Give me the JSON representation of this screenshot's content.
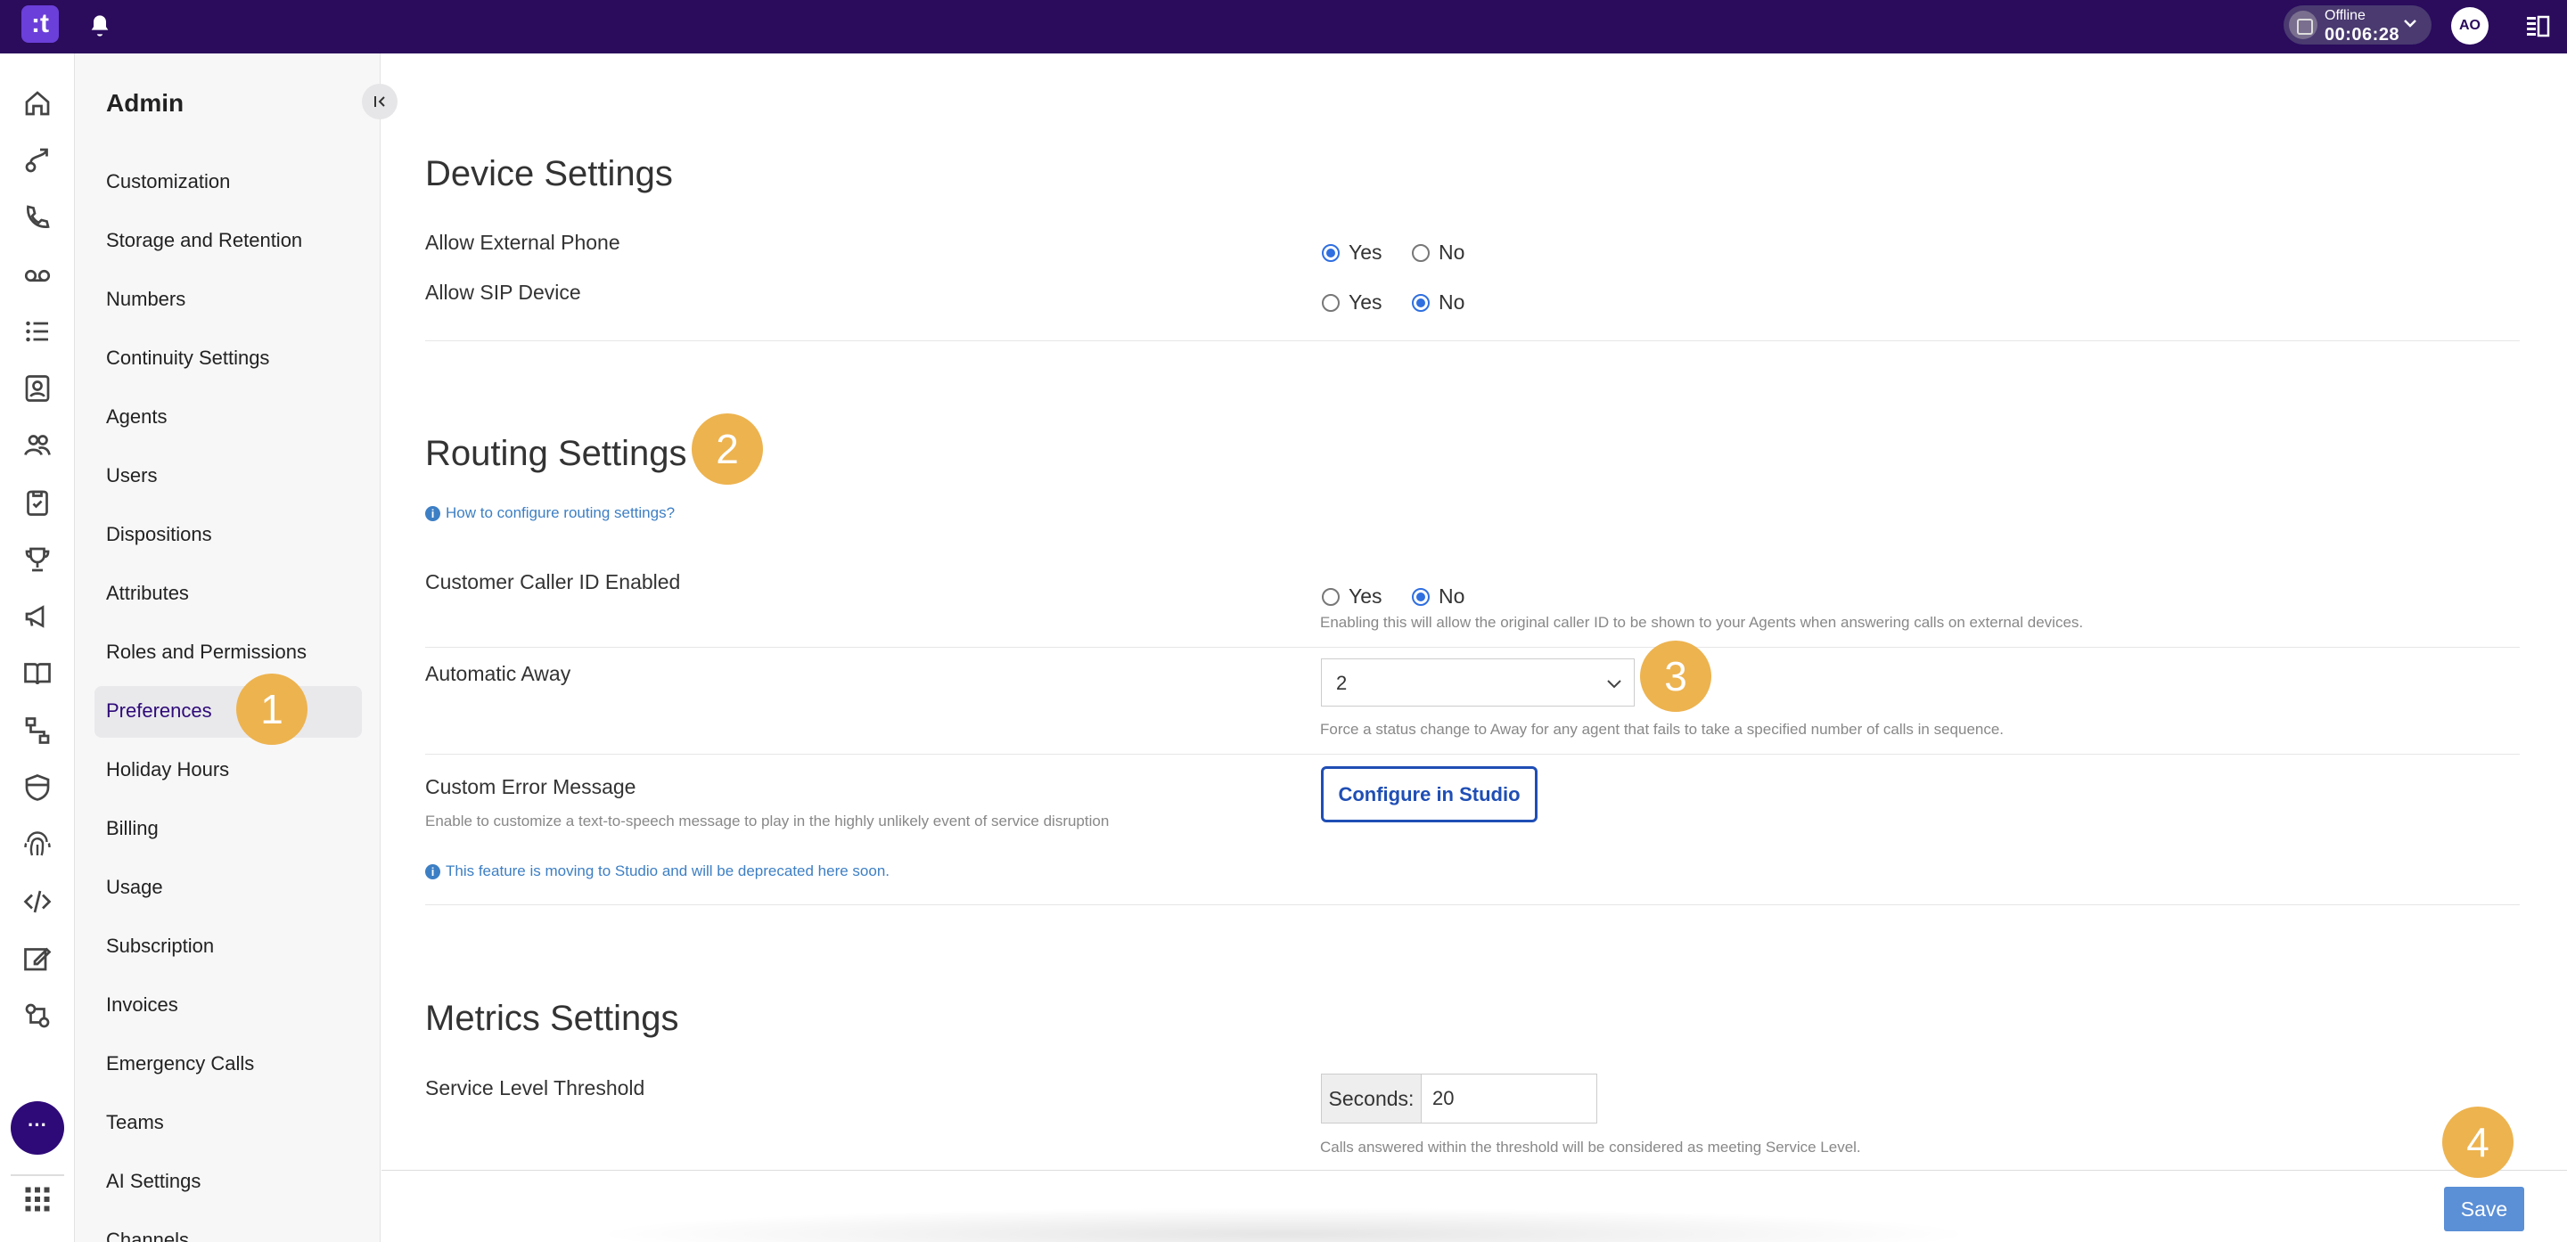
{
  "topbar": {
    "logo_text": ":t",
    "status_label": "Offline",
    "timer": "00:06:28",
    "avatar_initials": "AO"
  },
  "rail": {
    "icons": [
      "home-icon",
      "agent-routing-icon",
      "phone-icon",
      "voicemail-icon",
      "list-icon",
      "contact-book-icon",
      "team-icon",
      "clipboard-icon",
      "trophy-icon",
      "megaphone-icon",
      "book-icon",
      "flow-icon",
      "shield-icon",
      "fingerprint-icon",
      "code-icon",
      "edit-icon",
      "settings-flow-icon"
    ],
    "more_label": "···"
  },
  "sidebar": {
    "title": "Admin",
    "items": [
      {
        "label": "Customization"
      },
      {
        "label": "Storage and Retention"
      },
      {
        "label": "Numbers"
      },
      {
        "label": "Continuity Settings"
      },
      {
        "label": "Agents"
      },
      {
        "label": "Users"
      },
      {
        "label": "Dispositions"
      },
      {
        "label": "Attributes"
      },
      {
        "label": "Roles and Permissions"
      },
      {
        "label": "Preferences",
        "active": true
      },
      {
        "label": "Holiday Hours"
      },
      {
        "label": "Billing"
      },
      {
        "label": "Usage"
      },
      {
        "label": "Subscription"
      },
      {
        "label": "Invoices"
      },
      {
        "label": "Emergency Calls"
      },
      {
        "label": "Teams"
      },
      {
        "label": "AI Settings"
      },
      {
        "label": "Channels"
      }
    ]
  },
  "device": {
    "title": "Device Settings",
    "external_phone": {
      "label": "Allow External Phone",
      "yes": "Yes",
      "no": "No",
      "value": "Yes"
    },
    "sip_device": {
      "label": "Allow SIP Device",
      "yes": "Yes",
      "no": "No",
      "value": "No"
    }
  },
  "routing": {
    "title": "Routing Settings",
    "help_link": "How to configure routing settings?",
    "caller_id": {
      "label": "Customer Caller ID Enabled",
      "yes": "Yes",
      "no": "No",
      "value": "No",
      "description": "Enabling this will allow the original caller ID to be shown to your Agents when answering calls on external devices."
    },
    "auto_away": {
      "label": "Automatic Away",
      "value": "2",
      "description": "Force a status change to Away for any agent that fails to take a specified number of calls in sequence."
    },
    "custom_error": {
      "label": "Custom Error Message",
      "description": "Enable to customize a text-to-speech message to play in the highly unlikely event of service disruption",
      "button": "Configure in Studio",
      "notice": "This feature is moving to Studio and will be deprecated here soon."
    }
  },
  "metrics": {
    "title": "Metrics Settings",
    "sla": {
      "label": "Service Level Threshold",
      "addon": "Seconds:",
      "value": "20",
      "description": "Calls answered within the threshold will be considered as meeting Service Level."
    }
  },
  "footer": {
    "save_label": "Save"
  },
  "badges": [
    "1",
    "2",
    "3",
    "4"
  ],
  "colors": {
    "topbar": "#2a0b5c",
    "accent": "#2f6fe0",
    "badge": "#edb34f",
    "active_nav": "#2e0a78",
    "save": "#5b8fd6"
  }
}
